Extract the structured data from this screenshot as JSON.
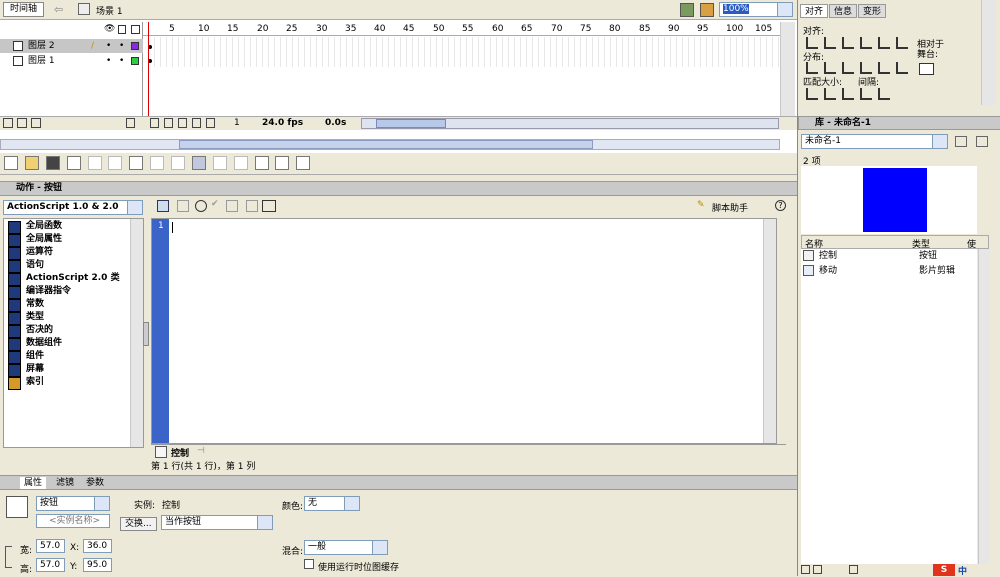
{
  "timeline": {
    "tab_label": "时间轴",
    "scene": "场景 1",
    "zoom": "100%",
    "layers": [
      {
        "name": "图层 2",
        "color": "#8a2be2"
      },
      {
        "name": "图层 1",
        "color": "#2ecc40"
      }
    ],
    "frame_numbers": [
      "1",
      "5",
      "10",
      "15",
      "20",
      "25",
      "30",
      "35",
      "40",
      "45",
      "50",
      "55",
      "60",
      "65",
      "70",
      "75",
      "80",
      "85",
      "90",
      "95",
      "100",
      "105"
    ],
    "current_frame": "1",
    "fps": "24.0 fps",
    "time": "0.0s"
  },
  "actions": {
    "title": "动作 - 按钮",
    "version": "ActionScript 1.0 & 2.0",
    "assist": "脚本助手",
    "toolbox_items": [
      "全局函数",
      "全局属性",
      "运算符",
      "语句",
      "ActionScript 2.0 类",
      "编译器指令",
      "常数",
      "类型",
      "否决的",
      "数据组件",
      "组件",
      "屏幕",
      "索引"
    ],
    "line_number": "1",
    "script_tab": "控制",
    "status": "第 1 行(共 1 行)，第 1 列"
  },
  "properties": {
    "tabs": [
      "属性",
      "滤镜",
      "参数"
    ],
    "symbol_type": "按钮",
    "instance_placeholder": "<实例名称>",
    "instance_label": "实例:",
    "instance_value": "控制",
    "swap_label": "交换...",
    "track_option": "当作按钮",
    "color_label": "颜色:",
    "color_value": "无",
    "blend_label": "混合:",
    "blend_value": "一般",
    "cache_label": "使用运行时位图缓存",
    "w_label": "宽:",
    "w_value": "57.0",
    "h_label": "高:",
    "h_value": "57.0",
    "x_label": "X:",
    "x_value": "36.0",
    "y_label": "Y:",
    "y_value": "95.0"
  },
  "align": {
    "tabs": [
      "对齐",
      "信息",
      "变形"
    ],
    "align_label": "对齐:",
    "distribute_label": "分布:",
    "match_label": "匹配大小:",
    "spacing_label": "间隔:",
    "relative_label": "相对于\n舞台:"
  },
  "library": {
    "title": "库 - 未命名-1",
    "document": "未命名-1",
    "count": "2 项",
    "preview_color": "#0000ff",
    "col_name": "名称",
    "col_type": "类型",
    "col_use": "使",
    "items": [
      {
        "name": "控制",
        "type": "按钮"
      },
      {
        "name": "移动",
        "type": "影片剪辑"
      }
    ]
  },
  "ime": {
    "mode": "中"
  }
}
